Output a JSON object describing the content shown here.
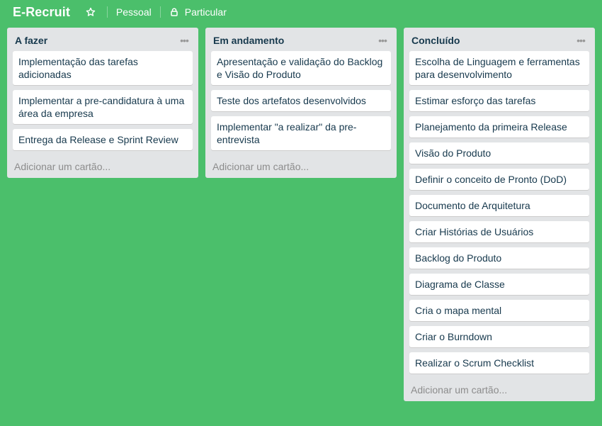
{
  "header": {
    "title": "E-Recruit",
    "star_icon": "star-icon",
    "team_label": "Pessoal",
    "visibility_icon": "lock-icon",
    "visibility_label": "Particular"
  },
  "lists": [
    {
      "title": "A fazer",
      "menu_icon": "ellipsis-icon",
      "cards": [
        "Implementação das tarefas adicionadas",
        "Implementar a pre-candidatura à uma área da empresa",
        "Entrega da Release e Sprint Review"
      ],
      "add_label": "Adicionar um cartão..."
    },
    {
      "title": "Em andamento",
      "menu_icon": "ellipsis-icon",
      "cards": [
        "Apresentação e validação do Backlog e Visão do Produto",
        "Teste dos artefatos desenvolvidos",
        "Implementar \"a realizar\" da pre-entrevista"
      ],
      "add_label": "Adicionar um cartão..."
    },
    {
      "title": "Concluído",
      "menu_icon": "ellipsis-icon",
      "cards": [
        "Escolha de Linguagem e ferramentas para desenvolvimento",
        "Estimar esforço das tarefas",
        "Planejamento da primeira Release",
        "Visão do Produto",
        "Definir o conceito de Pronto (DoD)",
        "Documento de Arquitetura",
        "Criar Histórias de Usuários",
        "Backlog do Produto",
        "Diagrama de Classe",
        "Cria o mapa mental",
        "Criar o Burndown",
        "Realizar o Scrum Checklist"
      ],
      "add_label": "Adicionar um cartão..."
    }
  ],
  "colors": {
    "board_background": "#4bbf6b",
    "list_background": "#e2e4e6",
    "card_background": "#ffffff"
  }
}
